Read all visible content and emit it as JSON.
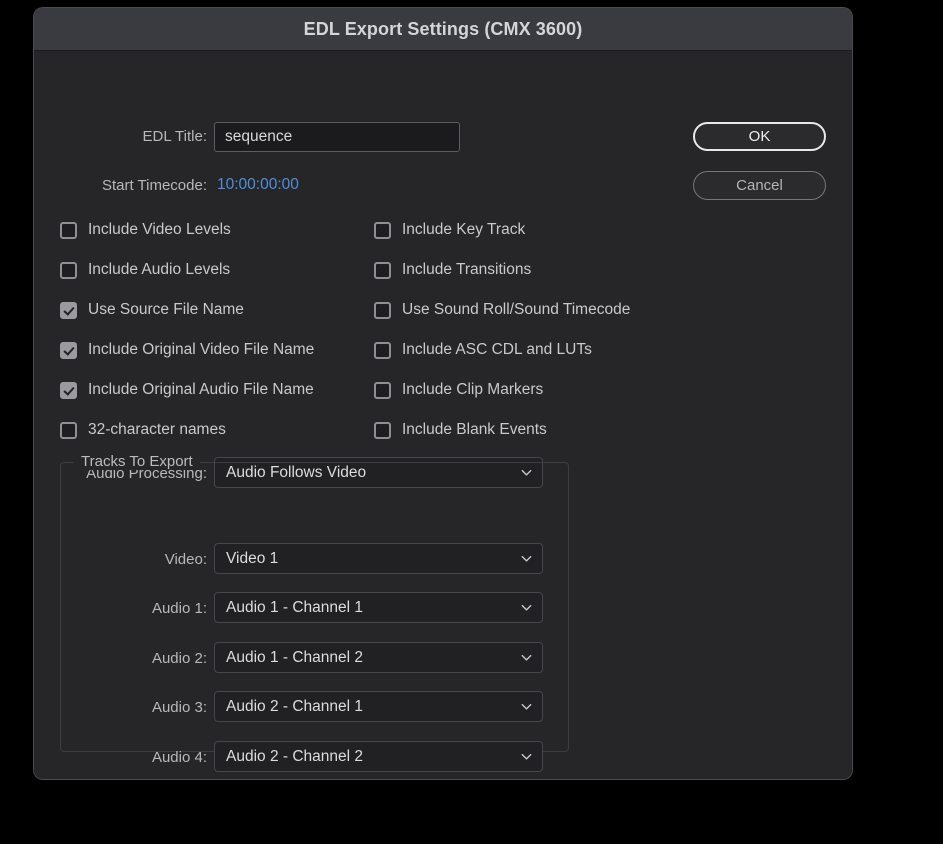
{
  "window": {
    "title": "EDL Export Settings (CMX 3600)"
  },
  "colors": {
    "dialog_background": "#262629",
    "titlebar_background": "#3a3a41",
    "timecode_accent": "#4f8fd8",
    "checkbox_checked_fill": "#9b9b9f",
    "text_primary": "#d8d8da",
    "text_label": "#b8b8ba"
  },
  "fields": {
    "edl_title": {
      "label": "EDL Title:",
      "value": "sequence",
      "placeholder": "sequence"
    },
    "start_timecode": {
      "label": "Start Timecode:",
      "value": "10:00:00:00"
    }
  },
  "buttons": {
    "ok": "OK",
    "cancel": "Cancel"
  },
  "checkboxes": {
    "left_column": [
      {
        "label": "Include Video Levels",
        "checked": false
      },
      {
        "label": "Include Audio Levels",
        "checked": false
      },
      {
        "label": "Use Source File Name",
        "checked": true
      },
      {
        "label": "Include Original Video File Name",
        "checked": true
      },
      {
        "label": "Include Original Audio File Name",
        "checked": true
      },
      {
        "label": "32-character names",
        "checked": false
      }
    ],
    "right_column": [
      {
        "label": "Include Key Track",
        "checked": false
      },
      {
        "label": "Include Transitions",
        "checked": false
      },
      {
        "label": "Use Sound Roll/Sound Timecode",
        "checked": false
      },
      {
        "label": "Include ASC CDL and LUTs",
        "checked": false
      },
      {
        "label": "Include Clip Markers",
        "checked": false
      },
      {
        "label": "Include Blank Events",
        "checked": false
      }
    ]
  },
  "audio_processing": {
    "label": "Audio Processing:",
    "value": "Audio Follows Video"
  },
  "tracks_to_export": {
    "legend": "Tracks To Export",
    "rows": [
      {
        "label": "Video:",
        "value": "Video 1"
      },
      {
        "label": "Audio 1:",
        "value": "Audio 1 - Channel 1"
      },
      {
        "label": "Audio 2:",
        "value": "Audio 1 - Channel 2"
      },
      {
        "label": "Audio 3:",
        "value": "Audio 2 - Channel 1"
      },
      {
        "label": "Audio 4:",
        "value": "Audio 2 - Channel 2"
      }
    ]
  },
  "icons": {
    "chevron_down": "chevron-down-icon",
    "checkmark": "checkmark-icon"
  }
}
